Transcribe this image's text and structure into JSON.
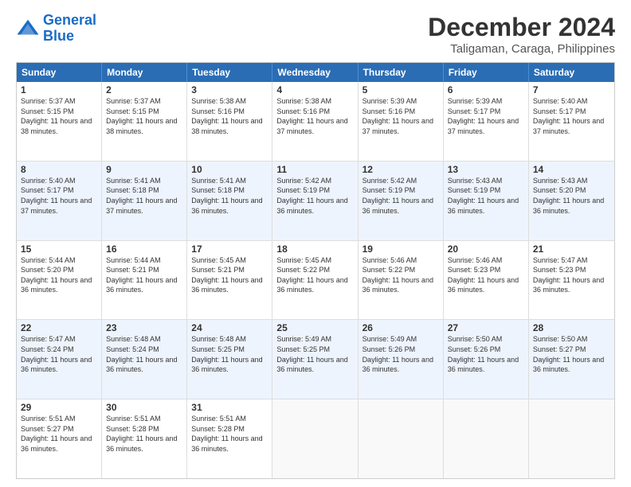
{
  "header": {
    "logo_line1": "General",
    "logo_line2": "Blue",
    "title": "December 2024",
    "subtitle": "Taligaman, Caraga, Philippines"
  },
  "calendar": {
    "days_of_week": [
      "Sunday",
      "Monday",
      "Tuesday",
      "Wednesday",
      "Thursday",
      "Friday",
      "Saturday"
    ],
    "weeks": [
      [
        {
          "day": "",
          "info": ""
        },
        {
          "day": "2",
          "info": "Sunrise: 5:37 AM\nSunset: 5:15 PM\nDaylight: 11 hours\nand 38 minutes."
        },
        {
          "day": "3",
          "info": "Sunrise: 5:38 AM\nSunset: 5:16 PM\nDaylight: 11 hours\nand 38 minutes."
        },
        {
          "day": "4",
          "info": "Sunrise: 5:38 AM\nSunset: 5:16 PM\nDaylight: 11 hours\nand 37 minutes."
        },
        {
          "day": "5",
          "info": "Sunrise: 5:39 AM\nSunset: 5:16 PM\nDaylight: 11 hours\nand 37 minutes."
        },
        {
          "day": "6",
          "info": "Sunrise: 5:39 AM\nSunset: 5:17 PM\nDaylight: 11 hours\nand 37 minutes."
        },
        {
          "day": "7",
          "info": "Sunrise: 5:40 AM\nSunset: 5:17 PM\nDaylight: 11 hours\nand 37 minutes."
        }
      ],
      [
        {
          "day": "8",
          "info": "Sunrise: 5:40 AM\nSunset: 5:17 PM\nDaylight: 11 hours\nand 37 minutes."
        },
        {
          "day": "9",
          "info": "Sunrise: 5:41 AM\nSunset: 5:18 PM\nDaylight: 11 hours\nand 37 minutes."
        },
        {
          "day": "10",
          "info": "Sunrise: 5:41 AM\nSunset: 5:18 PM\nDaylight: 11 hours\nand 36 minutes."
        },
        {
          "day": "11",
          "info": "Sunrise: 5:42 AM\nSunset: 5:19 PM\nDaylight: 11 hours\nand 36 minutes."
        },
        {
          "day": "12",
          "info": "Sunrise: 5:42 AM\nSunset: 5:19 PM\nDaylight: 11 hours\nand 36 minutes."
        },
        {
          "day": "13",
          "info": "Sunrise: 5:43 AM\nSunset: 5:19 PM\nDaylight: 11 hours\nand 36 minutes."
        },
        {
          "day": "14",
          "info": "Sunrise: 5:43 AM\nSunset: 5:20 PM\nDaylight: 11 hours\nand 36 minutes."
        }
      ],
      [
        {
          "day": "15",
          "info": "Sunrise: 5:44 AM\nSunset: 5:20 PM\nDaylight: 11 hours\nand 36 minutes."
        },
        {
          "day": "16",
          "info": "Sunrise: 5:44 AM\nSunset: 5:21 PM\nDaylight: 11 hours\nand 36 minutes."
        },
        {
          "day": "17",
          "info": "Sunrise: 5:45 AM\nSunset: 5:21 PM\nDaylight: 11 hours\nand 36 minutes."
        },
        {
          "day": "18",
          "info": "Sunrise: 5:45 AM\nSunset: 5:22 PM\nDaylight: 11 hours\nand 36 minutes."
        },
        {
          "day": "19",
          "info": "Sunrise: 5:46 AM\nSunset: 5:22 PM\nDaylight: 11 hours\nand 36 minutes."
        },
        {
          "day": "20",
          "info": "Sunrise: 5:46 AM\nSunset: 5:23 PM\nDaylight: 11 hours\nand 36 minutes."
        },
        {
          "day": "21",
          "info": "Sunrise: 5:47 AM\nSunset: 5:23 PM\nDaylight: 11 hours\nand 36 minutes."
        }
      ],
      [
        {
          "day": "22",
          "info": "Sunrise: 5:47 AM\nSunset: 5:24 PM\nDaylight: 11 hours\nand 36 minutes."
        },
        {
          "day": "23",
          "info": "Sunrise: 5:48 AM\nSunset: 5:24 PM\nDaylight: 11 hours\nand 36 minutes."
        },
        {
          "day": "24",
          "info": "Sunrise: 5:48 AM\nSunset: 5:25 PM\nDaylight: 11 hours\nand 36 minutes."
        },
        {
          "day": "25",
          "info": "Sunrise: 5:49 AM\nSunset: 5:25 PM\nDaylight: 11 hours\nand 36 minutes."
        },
        {
          "day": "26",
          "info": "Sunrise: 5:49 AM\nSunset: 5:26 PM\nDaylight: 11 hours\nand 36 minutes."
        },
        {
          "day": "27",
          "info": "Sunrise: 5:50 AM\nSunset: 5:26 PM\nDaylight: 11 hours\nand 36 minutes."
        },
        {
          "day": "28",
          "info": "Sunrise: 5:50 AM\nSunset: 5:27 PM\nDaylight: 11 hours\nand 36 minutes."
        }
      ],
      [
        {
          "day": "29",
          "info": "Sunrise: 5:51 AM\nSunset: 5:27 PM\nDaylight: 11 hours\nand 36 minutes."
        },
        {
          "day": "30",
          "info": "Sunrise: 5:51 AM\nSunset: 5:28 PM\nDaylight: 11 hours\nand 36 minutes."
        },
        {
          "day": "31",
          "info": "Sunrise: 5:51 AM\nSunset: 5:28 PM\nDaylight: 11 hours\nand 36 minutes."
        },
        {
          "day": "",
          "info": ""
        },
        {
          "day": "",
          "info": ""
        },
        {
          "day": "",
          "info": ""
        },
        {
          "day": "",
          "info": ""
        }
      ]
    ],
    "week0_day1": {
      "day": "1",
      "info": "Sunrise: 5:37 AM\nSunset: 5:15 PM\nDaylight: 11 hours\nand 38 minutes."
    }
  }
}
